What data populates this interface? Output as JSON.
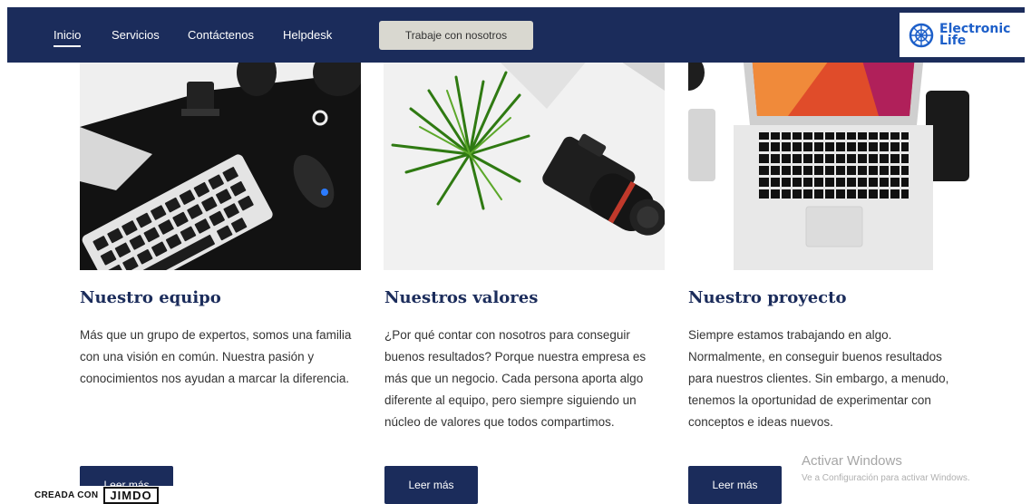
{
  "nav": {
    "links": [
      "Inicio",
      "Servicios",
      "Contáctenos",
      "Helpdesk"
    ],
    "cta": "Trabaje con nosotros",
    "logo_line1": "Electronic",
    "logo_line2": "Life"
  },
  "cards": [
    {
      "title": "Nuestro equipo",
      "body": "Más que un grupo de expertos, somos una familia con una visión en común. Nuestra pasión y conocimientos nos ayudan a marcar la diferencia.",
      "button": "Leer más"
    },
    {
      "title": "Nuestros valores",
      "body": "¿Por qué contar con nosotros para conseguir buenos resultados? Porque nuestra empresa es más que un negocio. Cada persona aporta algo diferente al equipo, pero siempre siguiendo un núcleo de valores que todos compartimos.",
      "button": "Leer más"
    },
    {
      "title": "Nuestro proyecto",
      "body": "Siempre estamos trabajando en algo. Normalmente, en conseguir buenos resultados para nuestros clientes. Sin embargo, a menudo, tenemos la oportunidad de experimentar con conceptos e ideas nuevos.",
      "button": "Leer más"
    }
  ],
  "watermark": {
    "title": "Activar Windows",
    "subtitle": "Ve a Configuración para activar Windows."
  },
  "badge": {
    "made_with": "CREADA CON",
    "brand": "JIMDO"
  },
  "colors": {
    "navy": "#1b2c5b",
    "logo_blue": "#1d5fc9"
  }
}
